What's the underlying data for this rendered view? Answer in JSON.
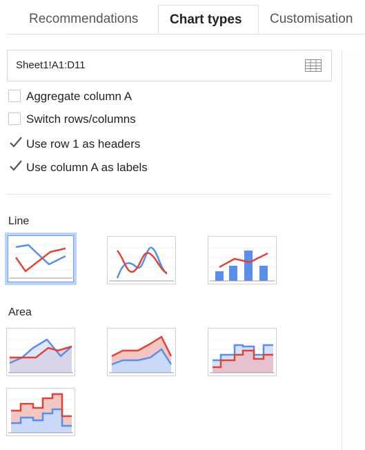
{
  "tabs": [
    {
      "label": "Recommendations"
    },
    {
      "label": "Chart types"
    },
    {
      "label": "Customisation"
    }
  ],
  "data_range": {
    "value": "Sheet1!A1:D11",
    "icon": "grid-icon"
  },
  "options": [
    {
      "label": "Aggregate column A",
      "checked": false
    },
    {
      "label": "Switch rows/columns",
      "checked": false
    },
    {
      "label": "Use row 1 as headers",
      "checked": true
    },
    {
      "label": "Use column A as labels",
      "checked": true
    }
  ],
  "sections": {
    "line": {
      "label": "Line",
      "thumbnails": [
        "line-chart",
        "smooth-line-chart",
        "combo-chart"
      ],
      "selected": "line-chart"
    },
    "area": {
      "label": "Area",
      "thumbnails": [
        "area-chart",
        "stacked-area-chart",
        "stepped-area-chart",
        "stacked-stepped-area-chart"
      ]
    }
  },
  "colors": {
    "blue": "#5b8ee6",
    "red": "#db4437",
    "selected_border": "#b9d3fb"
  }
}
